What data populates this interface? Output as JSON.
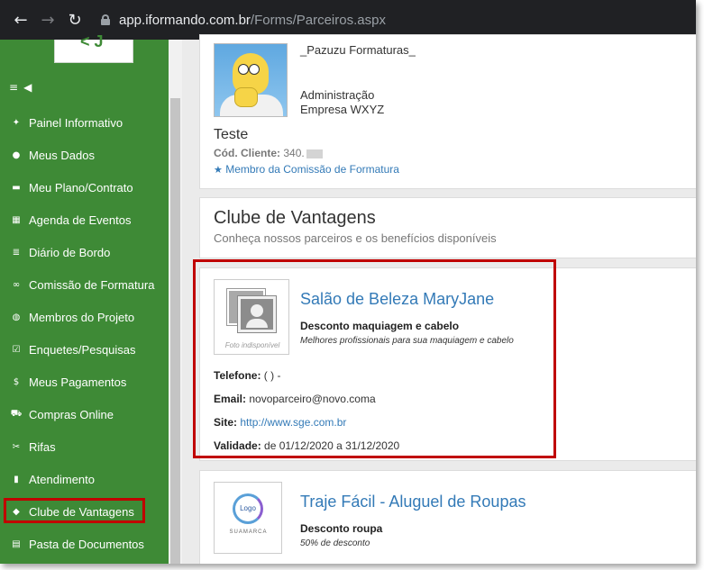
{
  "browser": {
    "url_host": "app.iformando.com.br",
    "url_path": "/Forms/Parceiros.aspx"
  },
  "sidebar": {
    "items": [
      {
        "label": "Painel Informativo",
        "icon": "pin-icon"
      },
      {
        "label": "Meus Dados",
        "icon": "user-icon"
      },
      {
        "label": "Meu Plano/Contrato",
        "icon": "folder-open-icon"
      },
      {
        "label": "Agenda de Eventos",
        "icon": "calendar-icon"
      },
      {
        "label": "Diário de Bordo",
        "icon": "list-icon"
      },
      {
        "label": "Comissão de Formatura",
        "icon": "link-icon"
      },
      {
        "label": "Membros do Projeto",
        "icon": "globe-icon"
      },
      {
        "label": "Enquetes/Pesquisas",
        "icon": "check-square-icon"
      },
      {
        "label": "Meus Pagamentos",
        "icon": "dollar-icon"
      },
      {
        "label": "Compras Online",
        "icon": "cart-icon"
      },
      {
        "label": "Rifas",
        "icon": "ticket-icon"
      },
      {
        "label": "Atendimento",
        "icon": "comment-icon"
      },
      {
        "label": "Clube de Vantagens",
        "icon": "tag-icon",
        "active": true
      },
      {
        "label": "Pasta de Documentos",
        "icon": "files-icon"
      }
    ]
  },
  "profile": {
    "name": "_Pazuzu Formaturas_",
    "role_line1": "Administração",
    "role_line2": "Empresa WXYZ",
    "user": "Teste",
    "code_label": "Cód. Cliente:",
    "code_value": "340.",
    "member": "Membro da Comissão de Formatura"
  },
  "clube": {
    "title": "Clube de Vantagens",
    "subtitle": "Conheça nossos parceiros e os benefícios disponíveis"
  },
  "partners": [
    {
      "name": "Salão de Beleza MaryJane",
      "photo_caption": "Foto indisponível",
      "discount": "Desconto maquiagem e cabelo",
      "detail": "Melhores profissionais para sua maquiagem e cabelo",
      "phone_label": "Telefone:",
      "phone": "( ) -",
      "email_label": "Email:",
      "email": "novoparceiro@novo.coma",
      "site_label": "Site:",
      "site": "http://www.sge.com.br",
      "validity_label": "Validade:",
      "validity": "de 01/12/2020 a 31/12/2020"
    },
    {
      "name": "Traje Fácil - Aluguel de Roupas",
      "logo_text": "Logo",
      "logo_caption": "SUAMARCA",
      "discount": "Desconto roupa",
      "detail": "50% de desconto"
    }
  ],
  "colors": {
    "sidebar": "#3e8a36",
    "highlight": "#c00000",
    "link": "#337ab7"
  }
}
